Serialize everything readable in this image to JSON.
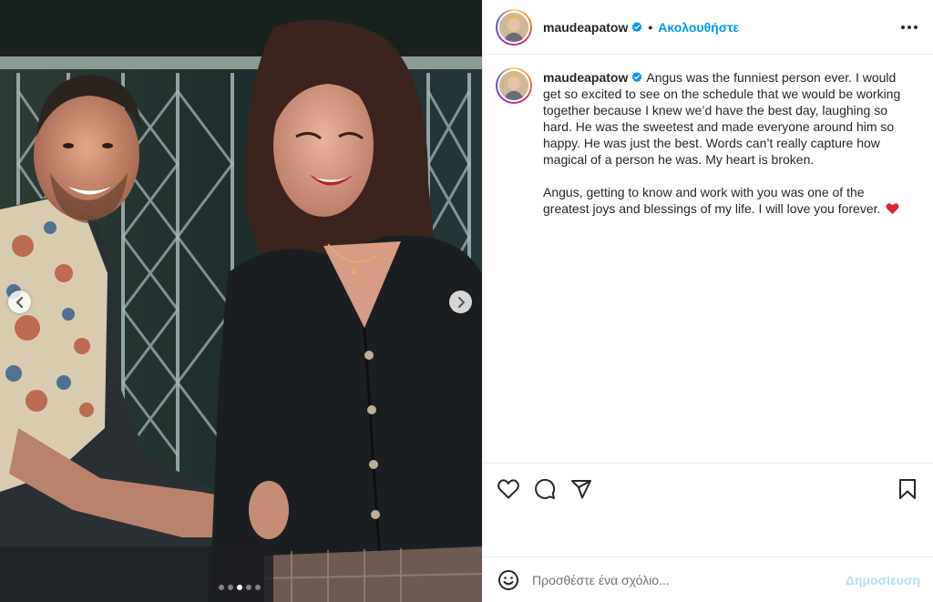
{
  "post": {
    "username": "maudeapatow",
    "separator": "•",
    "follow_label": "Ακολουθήστε",
    "more_icon": "more-horizontal-icon",
    "caption_paragraph_1": "Angus was the funniest person ever. I would get so excited to see on the schedule that we would be working together because I knew we’d have the best day, laughing so hard. He was the sweetest and made everyone around him so happy. He was just the best. Words can’t really capture how magical of a person he was. My heart is broken.",
    "caption_paragraph_2": "Angus, getting to know and work with you was one of the greatest joys and blessings of my life. I will love you forever.",
    "caption_emoji": "red-heart"
  },
  "carousel": {
    "slide_count": 5,
    "active_index": 2,
    "prev_icon": "chevron-left-icon",
    "next_icon": "chevron-right-icon"
  },
  "actions": {
    "icons": [
      "heart-icon",
      "comment-icon",
      "share-icon",
      "bookmark-icon"
    ]
  },
  "comment_box": {
    "placeholder": "Προσθέστε ένα σχόλιο...",
    "post_label": "Δημοσίευση",
    "emoji_icon": "smiley-icon"
  },
  "colors": {
    "accent": "#0095f6",
    "post_disabled": "#b2dffc",
    "verified": "#0095f6",
    "heart": "#ed4956"
  }
}
